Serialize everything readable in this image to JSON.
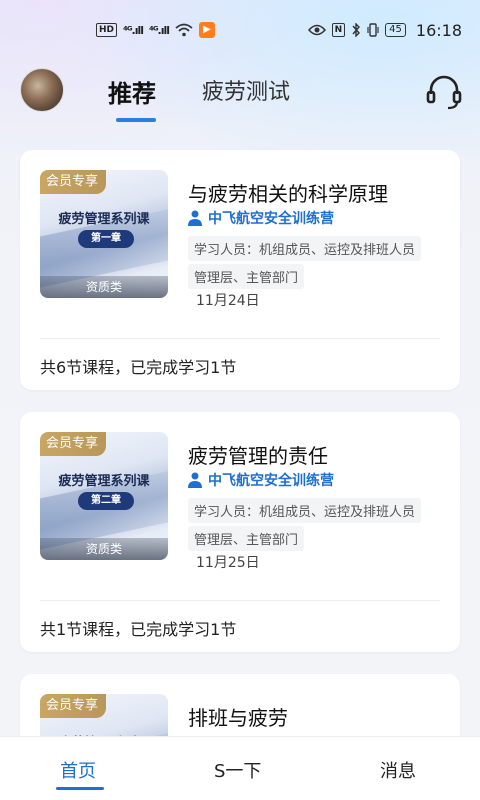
{
  "status_bar": {
    "hd_label": "HD",
    "signal1": "⁴ᴳ.ıll",
    "signal2": "⁴ᴳ.ıll",
    "app_badge": "▶",
    "nfc": "N",
    "battery": "45",
    "time": "16:18"
  },
  "header": {
    "tabs": [
      {
        "label": "推荐"
      },
      {
        "label": "疲劳测试"
      }
    ]
  },
  "courses": [
    {
      "badge": "会员专享",
      "thumb_title": "疲劳管理系列课",
      "thumb_chapter": "第一章",
      "thumb_footer": "资质类",
      "title": "与疲劳相关的科学原理",
      "org": "中飞航空安全训练营",
      "tags": [
        "学习人员：机组成员、运控及排班人员",
        "管理层、主管部门"
      ],
      "date": "11月24日",
      "progress": "共6节课程，已完成学习1节"
    },
    {
      "badge": "会员专享",
      "thumb_title": "疲劳管理系列课",
      "thumb_chapter": "第二章",
      "thumb_footer": "资质类",
      "title": "疲劳管理的责任",
      "org": "中飞航空安全训练营",
      "tags": [
        "学习人员：机组成员、运控及排班人员",
        "管理层、主管部门"
      ],
      "date": "11月25日",
      "progress": "共1节课程，已完成学习1节"
    },
    {
      "badge": "会员专享",
      "thumb_title": "疲劳管理系列课",
      "title": "排班与疲劳"
    }
  ],
  "bottom_nav": {
    "items": [
      {
        "label": "首页"
      },
      {
        "label": "S一下"
      },
      {
        "label": "消息"
      }
    ]
  },
  "colors": {
    "accent": "#1f6fd1",
    "badge_gold": "#c9a663"
  }
}
